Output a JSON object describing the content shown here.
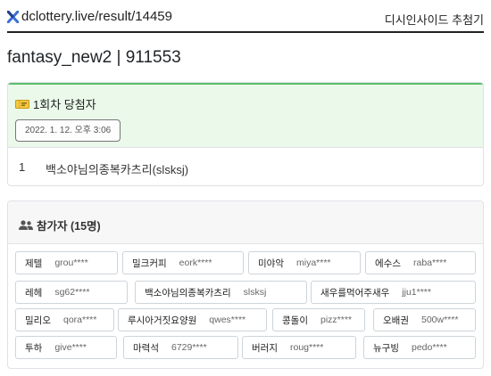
{
  "header": {
    "brand_text": "dclottery.live/result/14459",
    "brand_icon": "x-logo-icon",
    "right_label": "디시인사이드 추첨기"
  },
  "page_title": "fantasy_new2 | 911553",
  "winners": {
    "icon": "ticket-icon",
    "title": "1회차 당첨자",
    "date": "2022. 1. 12. 오후 3:06",
    "rows": [
      {
        "rank": "1",
        "name": "백소야님의종복카츠리(slsksj)"
      }
    ]
  },
  "participants": {
    "icon": "users-icon",
    "title": "참가자 (15명)",
    "items": [
      {
        "name": "제텔",
        "id": "grou****"
      },
      {
        "name": "밀크커피",
        "id": "eork****"
      },
      {
        "name": "미야악",
        "id": "miya****"
      },
      {
        "name": "에수스",
        "id": "raba****"
      },
      {
        "name": "레헤",
        "id": "sg62****"
      },
      {
        "name": "백소야님의종복카츠리",
        "id": "slsksj"
      },
      {
        "name": "새우를먹어주새우",
        "id": "jju1****"
      },
      {
        "name": "밀리오",
        "id": "qora****"
      },
      {
        "name": "루시아거짓요양원",
        "id": "qwes****"
      },
      {
        "name": "콩돌이",
        "id": "pizz****"
      },
      {
        "name": "오배권",
        "id": "500w****"
      },
      {
        "name": "투하",
        "id": "give****"
      },
      {
        "name": "마력석",
        "id": "6729****"
      },
      {
        "name": "버러지",
        "id": "roug****"
      },
      {
        "name": "뉴구빙",
        "id": "pedo****"
      }
    ]
  },
  "colors": {
    "accent_green": "#5cbf6b",
    "winner_bg": "#eaf9ea",
    "brand_blue": "#3b6fd6"
  }
}
